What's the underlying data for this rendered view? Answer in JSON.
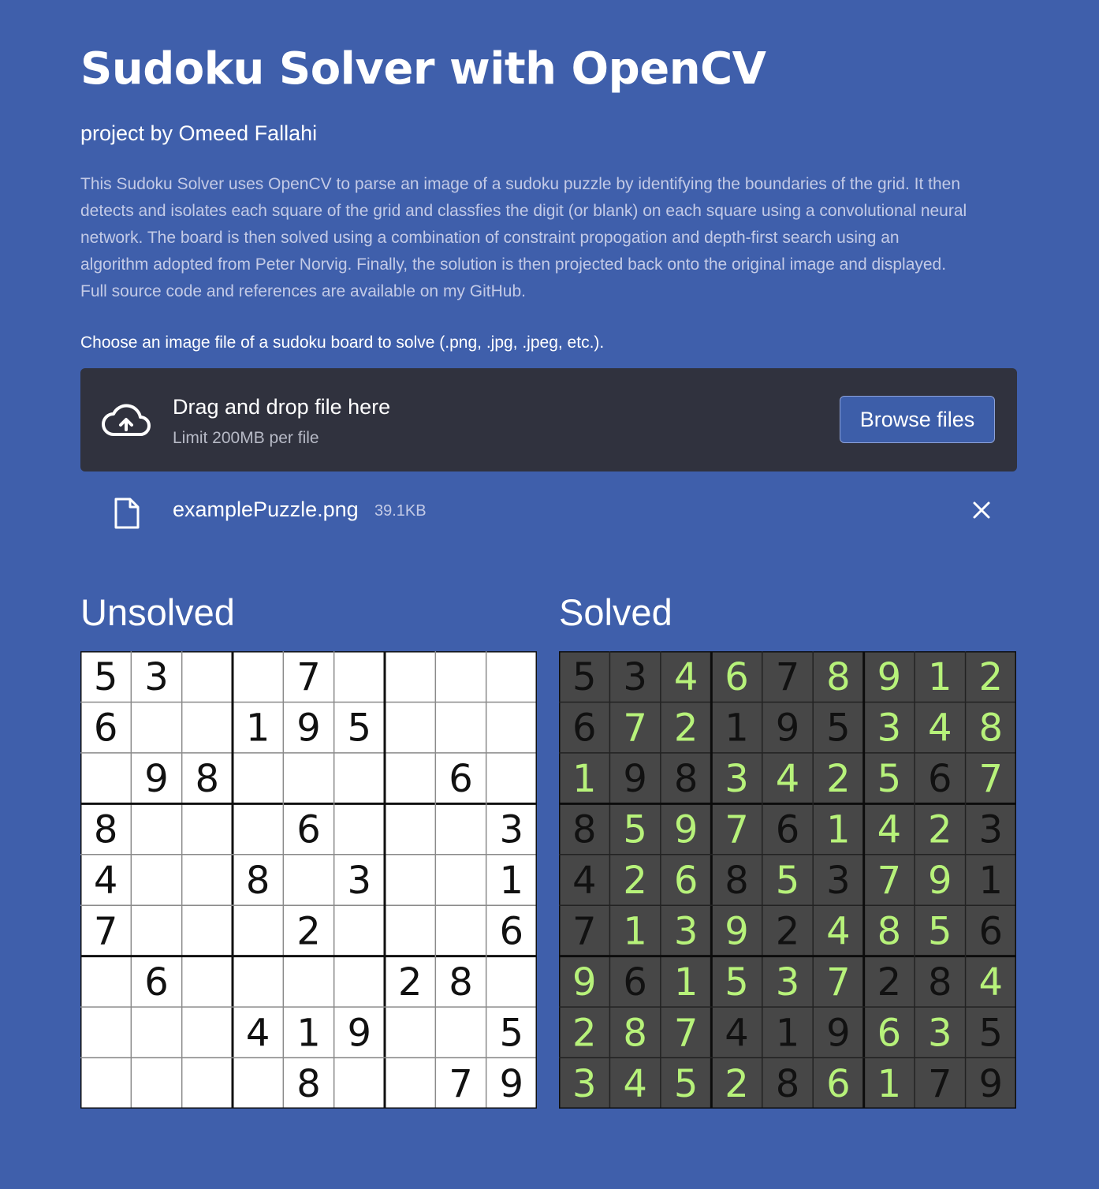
{
  "header": {
    "title": "Sudoku Solver with OpenCV",
    "subtitle": "project by Omeed Fallahi",
    "description_lines": [
      "This Sudoku Solver uses OpenCV to parse an image of a sudoku puzzle by identifying the boundaries of the grid. It then",
      "detects and isolates each square of the grid and classfies the digit (or blank) on each square using a convolutional neural",
      "network. The board is then solved using a combination of constraint propogation and depth-first search using an",
      "algorithm adopted from Peter Norvig. Finally, the solution is then projected back onto the original image and displayed.",
      "Full source code and references are available on my GitHub."
    ]
  },
  "uploader": {
    "label": "Choose an image file of a sudoku board to solve (.png, .jpg, .jpeg, etc.).",
    "dropzone_title": "Drag and drop file here",
    "dropzone_limit": "Limit 200MB per file",
    "browse_label": "Browse files",
    "icon": "cloud-upload-icon"
  },
  "uploaded_file": {
    "name": "examplePuzzle.png",
    "size": "39.1KB",
    "icon": "file-icon",
    "remove_icon": "close-icon"
  },
  "unsolved": {
    "title": "Unsolved",
    "rows": [
      "53..7....",
      "6..195...",
      ".98....6.",
      "8...6...3",
      "4..8.3..1",
      "7...2...6",
      ".6....28.",
      "...419..5",
      "....8..79"
    ]
  },
  "solved": {
    "title": "Solved",
    "rows": [
      "534678912",
      "672195348",
      "198342567",
      "859761423",
      "426853791",
      "713924856",
      "961537284",
      "287419635",
      "345286179"
    ]
  },
  "colors": {
    "background": "#3f5fab",
    "dropzone": "#30323e",
    "button": "#3d5ea9",
    "solved_board": "#474747",
    "given_digit": "#111111",
    "solved_digit": "#b7f27a"
  }
}
